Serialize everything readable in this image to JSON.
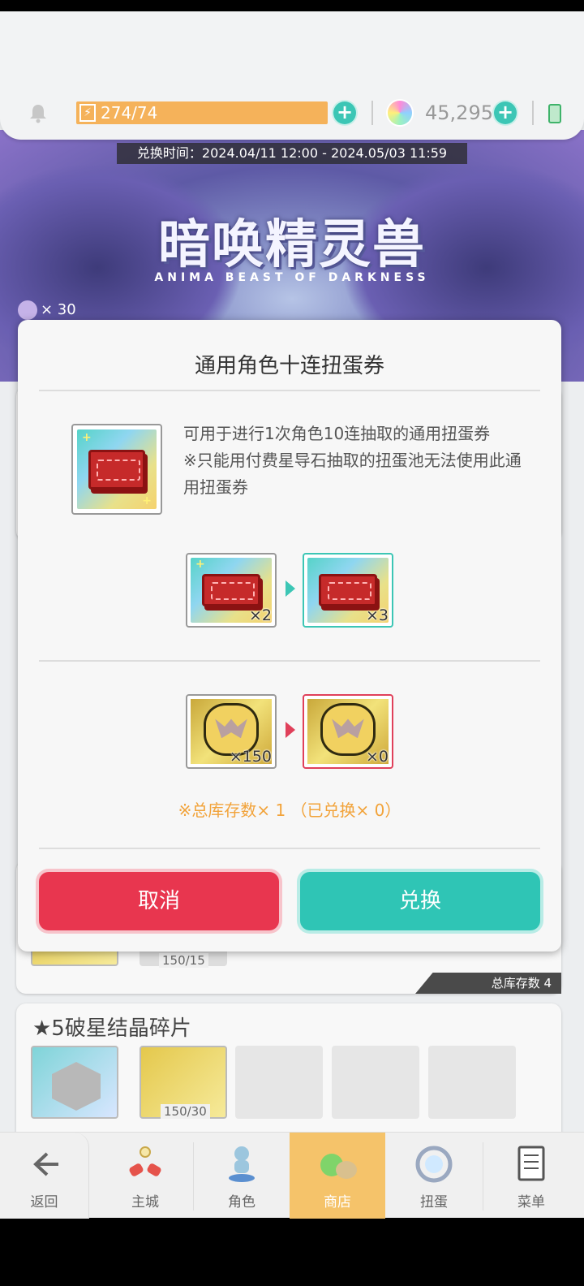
{
  "topbar": {
    "stamina": "274/74",
    "gems": "45,295"
  },
  "banner": {
    "exchange_period": "兑换时间：2024.04/11 12:00 - 2024.05/03 11:59",
    "title": "暗唤精灵兽",
    "subtitle": "ANIMA BEAST OF DARKNESS",
    "ticket_count": "× 30"
  },
  "modal": {
    "title": "通用角色十连扭蛋券",
    "description": "可用于进行1次角色10连抽取的通用扭蛋券\n※只能用付费星导石抽取的扭蛋池无法使用此通用扭蛋券",
    "ticket_before": "×2",
    "ticket_after": "×3",
    "coin_before": "×150",
    "coin_after": "×0",
    "note": "※总库存数× 1 （已兑换× 0）",
    "cancel_label": "取消",
    "confirm_label": "兑换"
  },
  "background_list": {
    "card1_count": "150/15",
    "card1_stock": "总库存数 4",
    "card2_title": "★5破星结晶碎片",
    "card2_count": "150/30"
  },
  "bottom_nav": {
    "back": "返回",
    "items": [
      "主城",
      "角色",
      "商店",
      "扭蛋",
      "菜单"
    ]
  },
  "colors": {
    "accent_teal": "#2fc5b5",
    "accent_red": "#e8364f",
    "note_orange": "#f2a33a",
    "stamina_orange": "#f5b25a"
  }
}
